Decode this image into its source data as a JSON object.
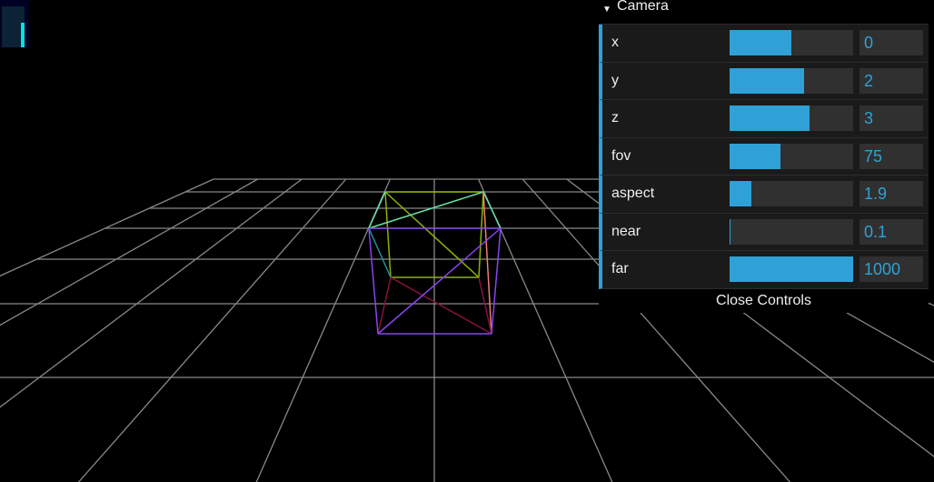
{
  "gui": {
    "folder_title": "Camera",
    "controls": [
      {
        "label": "x",
        "value": "0",
        "fraction": 0.5
      },
      {
        "label": "y",
        "value": "2",
        "fraction": 0.6
      },
      {
        "label": "z",
        "value": "3",
        "fraction": 0.65
      },
      {
        "label": "fov",
        "value": "75",
        "fraction": 0.41
      },
      {
        "label": "aspect",
        "value": "1.9",
        "fraction": 0.18
      },
      {
        "label": "near",
        "value": "0.1",
        "fraction": 0.005
      },
      {
        "label": "far",
        "value": "1000",
        "fraction": 1.0
      }
    ],
    "close_label": "Close Controls",
    "accent": "#2fa1d6"
  }
}
